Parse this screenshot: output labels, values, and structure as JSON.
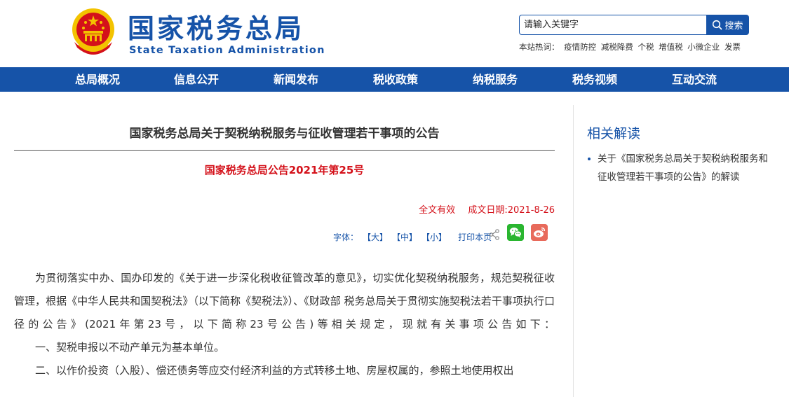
{
  "header": {
    "title_cn": "国家税务总局",
    "title_en": "State Taxation Administration",
    "search_placeholder": "请输入关键字",
    "search_button": "搜索",
    "hot_label": "本站热词：",
    "hot_words": [
      "疫情防控",
      "减税降费",
      "个税",
      "增值税",
      "小微企业",
      "发票"
    ]
  },
  "nav": {
    "items": [
      "总局概况",
      "信息公开",
      "新闻发布",
      "税收政策",
      "纳税服务",
      "税务视频",
      "互动交流"
    ]
  },
  "article": {
    "title": "国家税务总局关于契税纳税服务与征收管理若干事项的公告",
    "doc_number": "国家税务总局公告2021年第25号",
    "status": "全文有效",
    "date": "成文日期:2021-8-26",
    "font_label": "字体：",
    "size_large": "【大】",
    "size_medium": "【中】",
    "size_small": "【小】",
    "print": "打印本页",
    "paragraphs": [
      "为贯彻落实中办、国办印发的《关于进一步深化税收征管改革的意见》，切实优化契税纳税服务，规范契税征收管理，根据《中华人民共和国契税法》（以下简称《契税法》）、《财政部 税务总局关于贯彻实施契税法若干事项执行口径的公告》(2021年第23号，以下简称23号公告)等相关规定，现就有关事项公告如下：",
      "一、契税申报以不动产单元为基本单位。",
      "二、以作价投资（入股）、偿还债务等应交付经济利益的方式转移土地、房屋权属的，参照土地使用权出"
    ]
  },
  "sidebar": {
    "title": "相关解读",
    "items": [
      "关于《国家税务总局关于契税纳税服务和征收管理若干事项的公告》的解读"
    ]
  },
  "colors": {
    "brand_blue": "#1653a8",
    "accent_red": "#d4111a",
    "wechat_green": "#2ab630",
    "weibo_red": "#e86a5b"
  }
}
